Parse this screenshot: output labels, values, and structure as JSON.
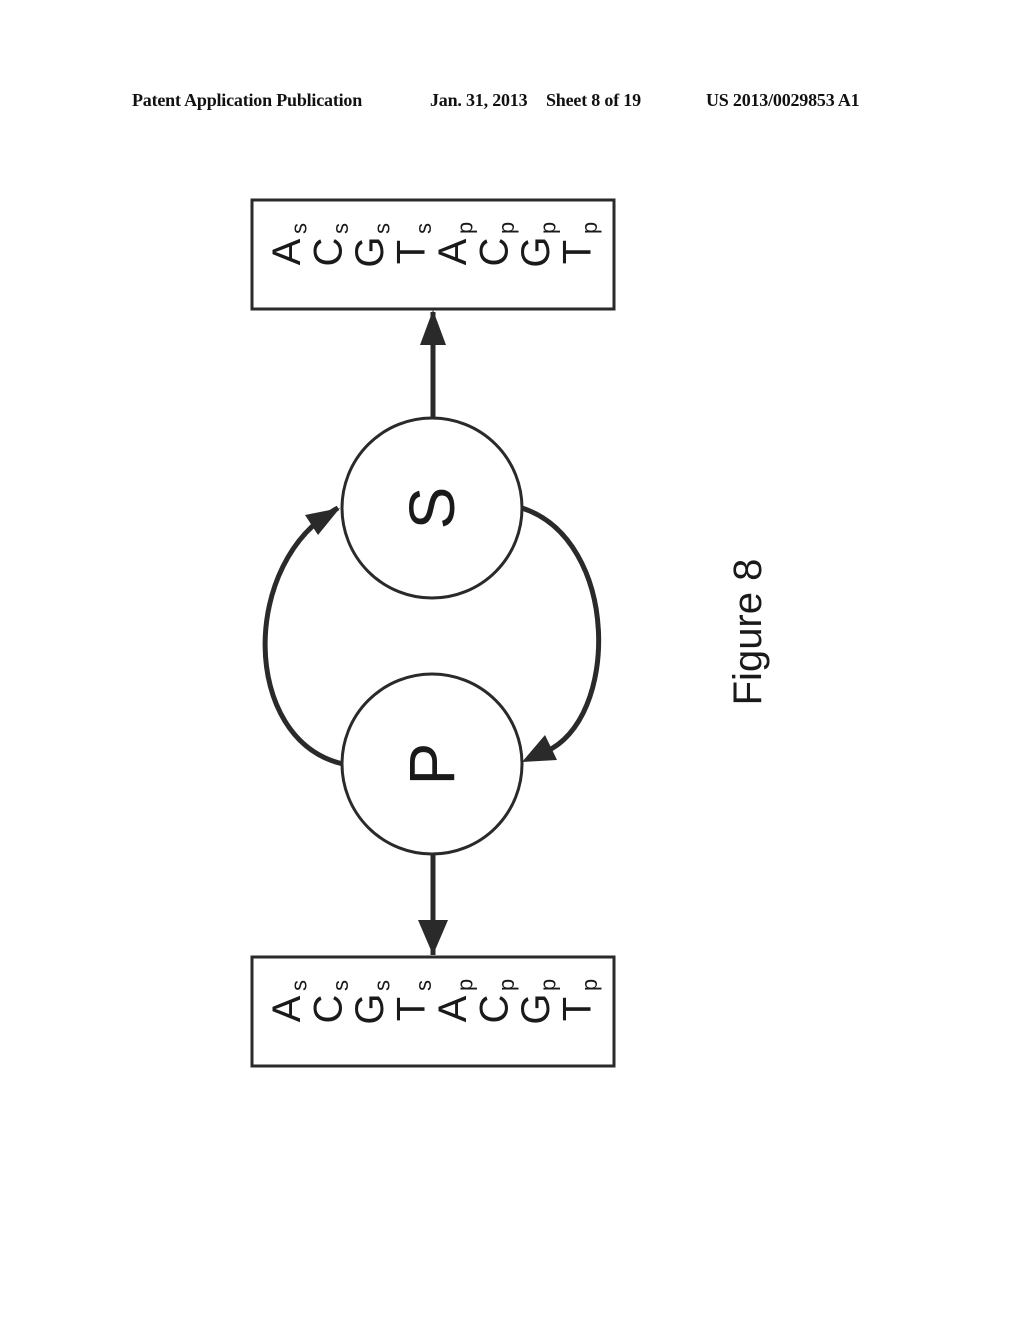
{
  "header": {
    "publication": "Patent Application Publication",
    "date": "Jan. 31, 2013",
    "sheet": "Sheet 8 of 19",
    "number": "US 2013/0029853 A1"
  },
  "figure": {
    "caption": "Figure 8",
    "nodes": [
      {
        "id": "S",
        "label": "S"
      },
      {
        "id": "P",
        "label": "P"
      }
    ],
    "edges": [
      {
        "from": "P",
        "to": "S",
        "type": "curved-arrow",
        "side": "left"
      },
      {
        "from": "S",
        "to": "P",
        "type": "curved-arrow",
        "side": "right"
      },
      {
        "from": "S",
        "to": "top-box",
        "type": "straight-arrow"
      },
      {
        "from": "P",
        "to": "bottom-box",
        "type": "straight-arrow"
      }
    ],
    "top_box": {
      "items": [
        {
          "base": "A",
          "sub": "s"
        },
        {
          "base": "C",
          "sub": "s"
        },
        {
          "base": "G",
          "sub": "s"
        },
        {
          "base": "T",
          "sub": "s"
        },
        {
          "base": "A",
          "sub": "p"
        },
        {
          "base": "C",
          "sub": "p"
        },
        {
          "base": "G",
          "sub": "p"
        },
        {
          "base": "T",
          "sub": "p"
        }
      ]
    },
    "bottom_box": {
      "items": [
        {
          "base": "A",
          "sub": "s"
        },
        {
          "base": "C",
          "sub": "s"
        },
        {
          "base": "G",
          "sub": "s"
        },
        {
          "base": "T",
          "sub": "s"
        },
        {
          "base": "A",
          "sub": "p"
        },
        {
          "base": "C",
          "sub": "p"
        },
        {
          "base": "G",
          "sub": "p"
        },
        {
          "base": "T",
          "sub": "p"
        }
      ]
    }
  }
}
